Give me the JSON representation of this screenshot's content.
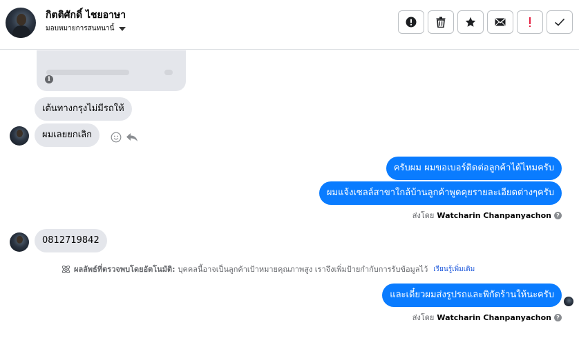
{
  "header": {
    "contact_name": "กิตติศักดิ์ ไชยอาษา",
    "assign_label": "มอบหมายการสนทนานี้"
  },
  "toolbar": [
    {
      "icon": "alert-circle-icon",
      "name": "spam-button"
    },
    {
      "icon": "trash-icon",
      "name": "delete-button"
    },
    {
      "icon": "star-icon",
      "name": "star-button"
    },
    {
      "icon": "envelope-icon",
      "name": "mark-unread-button"
    },
    {
      "icon": "exclamation-icon",
      "name": "follow-up-button"
    },
    {
      "icon": "check-icon",
      "name": "mark-done-button"
    }
  ],
  "messages": {
    "in1": "เต้นทางกรุงไม่มีรถให้",
    "in2": "ผมเลยยกเลิก",
    "out1": "ครับผม ผมขอเบอร์ติดต่อลูกค้าได้ไหมครับ",
    "out2": "ผมแจ้งเซลล์สาขาใกล้บ้านลูกค้าพูดคุยรายละเอียดต่างๆครับ",
    "sent_by_prefix": "ส่งโดย",
    "sent_by_name": "Watcharin Chanpanyachon",
    "in3": "0812719842",
    "auto_detect_label": "ผลลัพธ์ที่ตรวจพบโดยอัตโนมัติ:",
    "auto_detect_text": "บุคคลนี้อาจเป็นลูกค้าเป้าหมายคุณภาพสูง เราจึงเพิ่มป้ายกำกับการรับข้อมูลไว้",
    "auto_detect_link": "เรียนรู้เพิ่มเติม",
    "out3": "และเดี๋ยวผมส่งรูปรถและพิกัดร้านให้นะครับ"
  },
  "colors": {
    "outgoing_bubble": "#0a7cff",
    "incoming_bubble": "#e4e6eb",
    "link": "#1a56db"
  }
}
